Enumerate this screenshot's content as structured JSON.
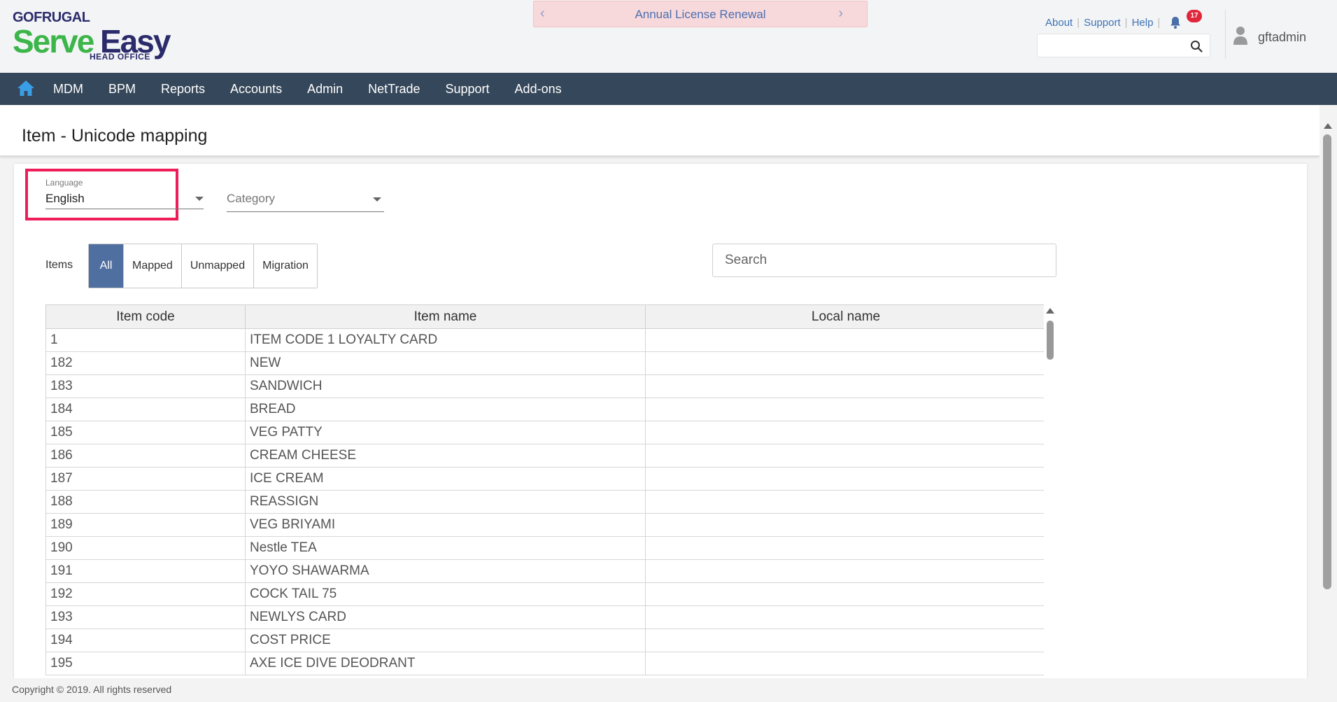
{
  "header": {
    "logo": {
      "brand": "GOFRUGAL",
      "product_part1": "Serve",
      "product_part2": "Easy",
      "subtitle": "HEAD OFFICE"
    },
    "banner": {
      "text": "Annual License Renewal",
      "prev": "‹",
      "next": "›"
    },
    "links": [
      "About",
      "Support",
      "Help"
    ],
    "notification_count": "17",
    "search_placeholder": "",
    "username": "gftadmin"
  },
  "nav": {
    "items": [
      "MDM",
      "BPM",
      "Reports",
      "Accounts",
      "Admin",
      "NetTrade",
      "Support",
      "Add-ons"
    ],
    "accent": "#35475a"
  },
  "page": {
    "title": "Item - Unicode mapping"
  },
  "filters": {
    "language": {
      "label": "Language",
      "value": "English"
    },
    "category": {
      "label": "Category",
      "value": ""
    }
  },
  "items_filter": {
    "label": "Items",
    "options": [
      "All",
      "Mapped",
      "Unmapped",
      "Migration"
    ],
    "active": "All",
    "active_color": "#4f6fa0"
  },
  "search": {
    "placeholder": "Search",
    "value": ""
  },
  "table": {
    "columns": [
      "Item code",
      "Item name",
      "Local name"
    ],
    "rows": [
      [
        "1",
        "ITEM CODE 1 LOYALTY CARD",
        ""
      ],
      [
        "182",
        "NEW",
        ""
      ],
      [
        "183",
        "SANDWICH",
        ""
      ],
      [
        "184",
        "BREAD",
        ""
      ],
      [
        "185",
        "VEG PATTY",
        ""
      ],
      [
        "186",
        "CREAM CHEESE",
        ""
      ],
      [
        "187",
        "ICE CREAM",
        ""
      ],
      [
        "188",
        "REASSIGN",
        ""
      ],
      [
        "189",
        "VEG BRIYAMI",
        ""
      ],
      [
        "190",
        "Nestle TEA",
        ""
      ],
      [
        "191",
        "YOYO SHAWARMA",
        ""
      ],
      [
        "192",
        "COCK TAIL 75",
        ""
      ],
      [
        "193",
        "NEWLYS CARD",
        ""
      ],
      [
        "194",
        "COST PRICE",
        ""
      ],
      [
        "195",
        "AXE ICE DIVE DEODRANT",
        ""
      ]
    ]
  },
  "footer": {
    "copyright": "Copyright © 2019. All rights reserved"
  },
  "colors": {
    "highlight": "#ee1d5a",
    "link": "#3d73b5",
    "badge": "#e0263a"
  }
}
